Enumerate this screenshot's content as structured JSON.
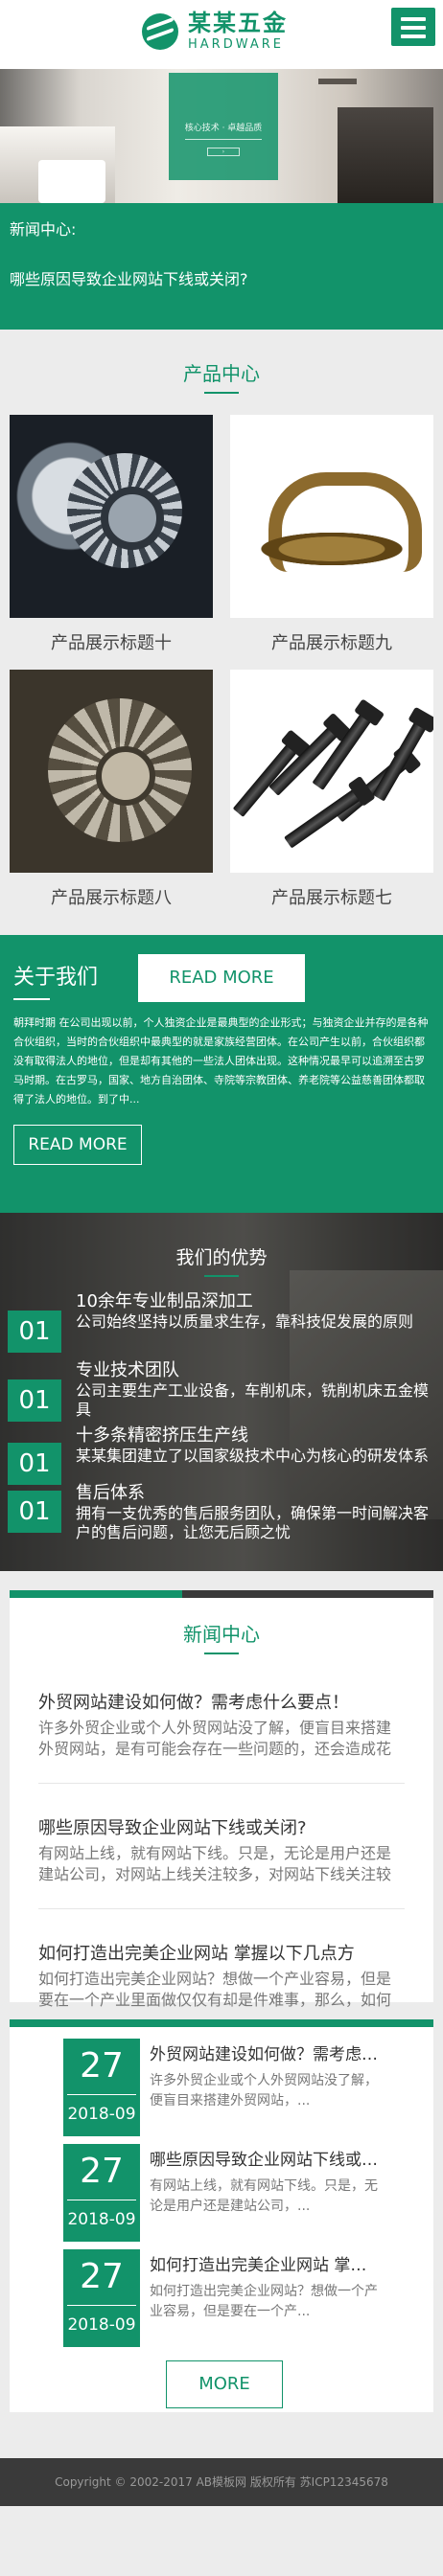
{
  "header": {
    "logo_cn": "某某五金",
    "logo_en": "HARDWARE"
  },
  "banner": {
    "tagline": "核心技术 · 卓越品质"
  },
  "news_strip": {
    "label": "新闻中心:",
    "headline": "哪些原因导致企业网站下线或关闭?"
  },
  "products": {
    "title": "产品中心",
    "items": [
      {
        "caption": "产品展示标题十",
        "image": "gears-image"
      },
      {
        "caption": "产品展示标题九",
        "image": "brass-handle-image"
      },
      {
        "caption": "产品展示标题八",
        "image": "gear-assembly-image"
      },
      {
        "caption": "产品展示标题七",
        "image": "bolts-image"
      }
    ],
    "more_label": "READ MORE"
  },
  "about": {
    "title": "关于我们",
    "text": "朝拜时期 在公司出现以前，个人独资企业是最典型的企业形式；与独资企业并存的是各种合伙组织，当时的合伙组织中最典型的就是家族经营团体。在公司产生以前，合伙组织都没有取得法人的地位，但是却有其他的一些法人团体出现。这种情况最早可以追溯至古罗马时期。在古罗马，国家、地方自治团体、寺院等宗教团体、养老院等公益慈善团体都取得了法人的地位。到了中...",
    "more_label": "READ MORE"
  },
  "advantages": {
    "title": "我们的优势",
    "items": [
      {
        "num": "01",
        "heading": "10余年专业制品深加工",
        "desc": "公司始终坚持以质量求生存，靠科技促发展的原则"
      },
      {
        "num": "01",
        "heading": "专业技术团队",
        "desc": "公司主要生产工业设备，车削机床，铣削机床五金模具"
      },
      {
        "num": "01",
        "heading": "十多条精密挤压生产线",
        "desc": "某某集团建立了以国家级技术中心为核心的研发体系"
      },
      {
        "num": "01",
        "heading": "售后体系",
        "desc": "拥有一支优秀的售后服务团队，确保第一时间解决客户的售后问题，让您无后顾之忧"
      }
    ]
  },
  "news": {
    "title": "新闻中心",
    "items": [
      {
        "title": "外贸网站建设如何做？需考虑什么要点！",
        "desc": "许多外贸企业或个人外贸网站没了解，便盲目来搭建外贸网站，是有可能会存在一些问题的，还会造成花费许"
      },
      {
        "title": "哪些原因导致企业网站下线或关闭?",
        "desc": "有网站上线，就有网站下线。只是，无论是用户还是建站公司，对网站上线关注较多，对网站下线关注较少而"
      },
      {
        "title": "如何打造出完美企业网站 掌握以下几点方",
        "desc": "如何打造出完美企业网站？想做一个产业容易，但是要在一个产业里面做仅仅有却是件难事，那么，如何才能"
      }
    ]
  },
  "dated_news": {
    "items": [
      {
        "day": "27",
        "ym": "2018-09",
        "title": "外贸网站建设如何做？需考虑什么要点！",
        "desc": "许多外贸企业或个人外贸网站没了解，便盲目来搭建外贸网站，..."
      },
      {
        "day": "27",
        "ym": "2018-09",
        "title": "哪些原因导致企业网站下线或关闭?",
        "desc": "有网站上线，就有网站下线。只是，无论是用户还是建站公司，..."
      },
      {
        "day": "27",
        "ym": "2018-09",
        "title": "如何打造出完美企业网站 掌握以下几点方",
        "desc": "如何打造出完美企业网站？想做一个产业容易，但是要在一个产..."
      }
    ],
    "more_label": "MORE"
  },
  "footer": {
    "text": "Copyright © 2002-2017 AB模板网 版权所有 苏ICP12345678"
  }
}
